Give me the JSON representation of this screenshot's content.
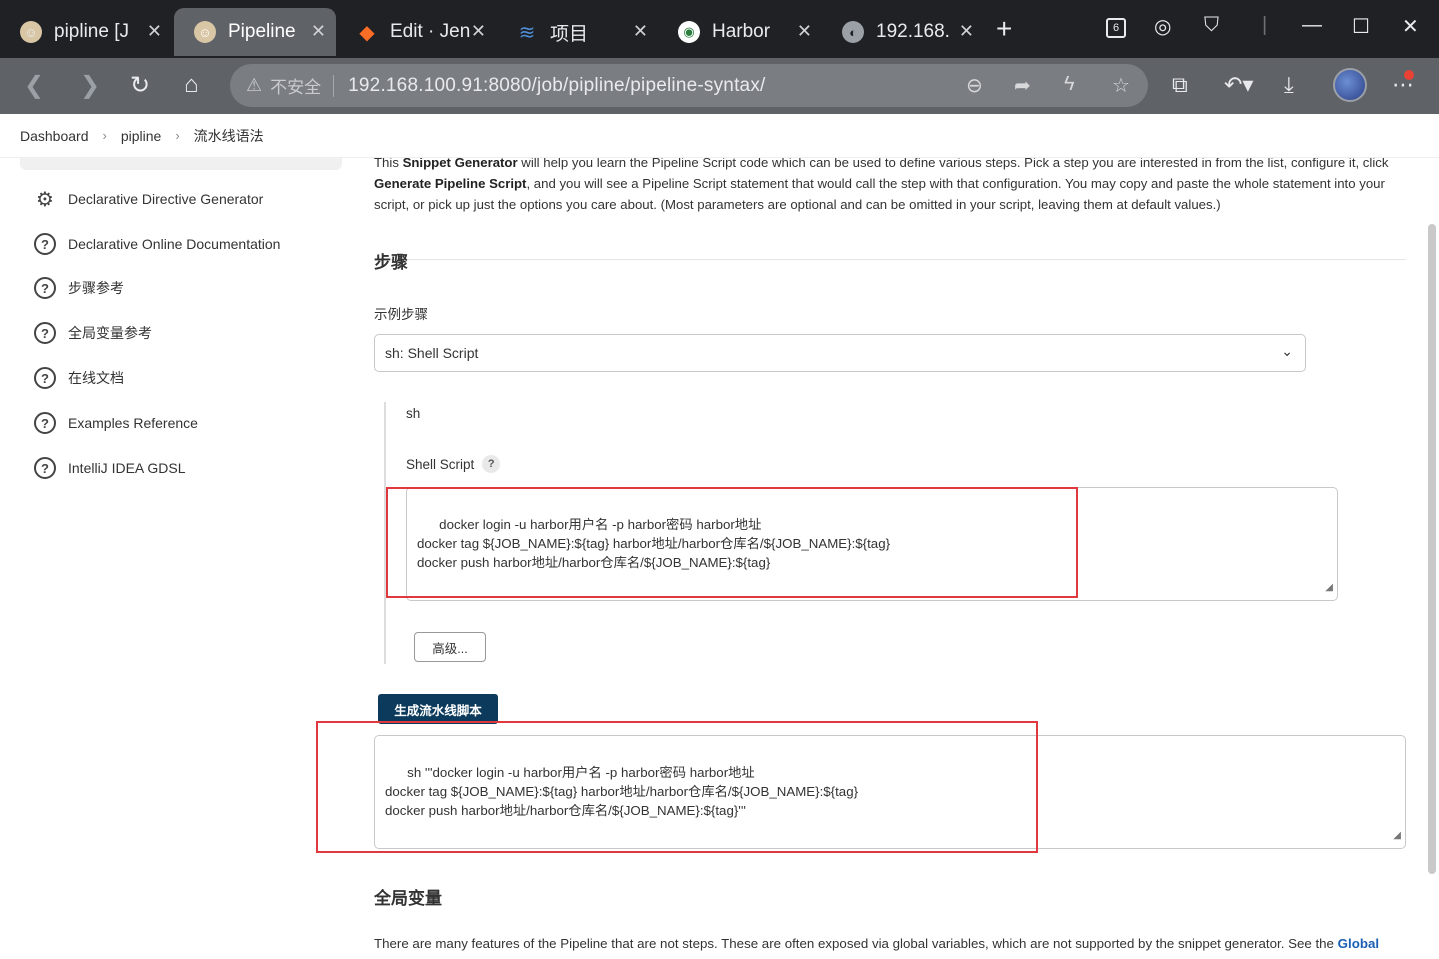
{
  "browser": {
    "tabs": [
      {
        "title": "pipline [J",
        "active": false
      },
      {
        "title": "Pipeline",
        "active": true
      },
      {
        "title": "Edit · Jen",
        "active": false
      },
      {
        "title": "项目",
        "active": false
      },
      {
        "title": "Harbor",
        "active": false
      },
      {
        "title": "192.168.",
        "active": false
      }
    ],
    "tab_badge": "6",
    "address": {
      "warning": "不安全",
      "url": "192.168.100.91:8080/job/pipline/pipeline-syntax/"
    }
  },
  "breadcrumb": {
    "items": [
      "Dashboard",
      "pipline",
      "流水线语法"
    ]
  },
  "sidebar": {
    "items": [
      {
        "label": "Declarative Directive Generator",
        "icon": "gear-icon"
      },
      {
        "label": "Declarative Online Documentation",
        "icon": "help-circle-icon"
      },
      {
        "label": "步骤参考",
        "icon": "help-circle-icon"
      },
      {
        "label": "全局变量参考",
        "icon": "help-circle-icon"
      },
      {
        "label": "在线文档",
        "icon": "help-circle-icon"
      },
      {
        "label": "Examples Reference",
        "icon": "help-circle-icon"
      },
      {
        "label": "IntelliJ IDEA GDSL",
        "icon": "help-circle-icon"
      }
    ]
  },
  "main": {
    "intro": {
      "p1": "This ",
      "b1": "Snippet Generator",
      "p2": " will help you learn the Pipeline Script code which can be used to define various steps. Pick a step you are interested in from the list, configure it, click ",
      "b2": "Generate Pipeline Script",
      "p3": ", and you will see a Pipeline Script statement that would call the step with that configuration. You may copy and paste the whole statement into your script, or pick up just the options you care about. (Most parameters are optional and can be omitted in your script, leaving them at default values.)"
    },
    "steps_heading": "步骤",
    "sample_step_label": "示例步骤",
    "sample_step_value": "sh: Shell Script",
    "step_name": "sh",
    "shell_script_label": "Shell Script",
    "help_mark": "?",
    "shell_script_value": "docker login -u harbor用户名 -p harbor密码 harbor地址\ndocker tag ${JOB_NAME}:${tag} harbor地址/harbor仓库名/${JOB_NAME}:${tag}\ndocker push harbor地址/harbor仓库名/${JOB_NAME}:${tag}",
    "advanced_button": "高级...",
    "generate_button": "生成流水线脚本",
    "generated_output": "sh '''docker login -u harbor用户名 -p harbor密码 harbor地址\ndocker tag ${JOB_NAME}:${tag} harbor地址/harbor仓库名/${JOB_NAME}:${tag}\ndocker push harbor地址/harbor仓库名/${JOB_NAME}:${tag}'''",
    "global_vars_heading": "全局变量",
    "global_vars_text": "There are many features of the Pipeline that are not steps. These are often exposed via global variables, which are not supported by the snippet generator. See the ",
    "global_vars_link": "Global"
  },
  "colors": {
    "tabbar_bg": "#202124",
    "toolbar_bg": "#5f6368",
    "generate_button_bg": "#0b3a5c",
    "highlight_red": "#e0383e"
  }
}
